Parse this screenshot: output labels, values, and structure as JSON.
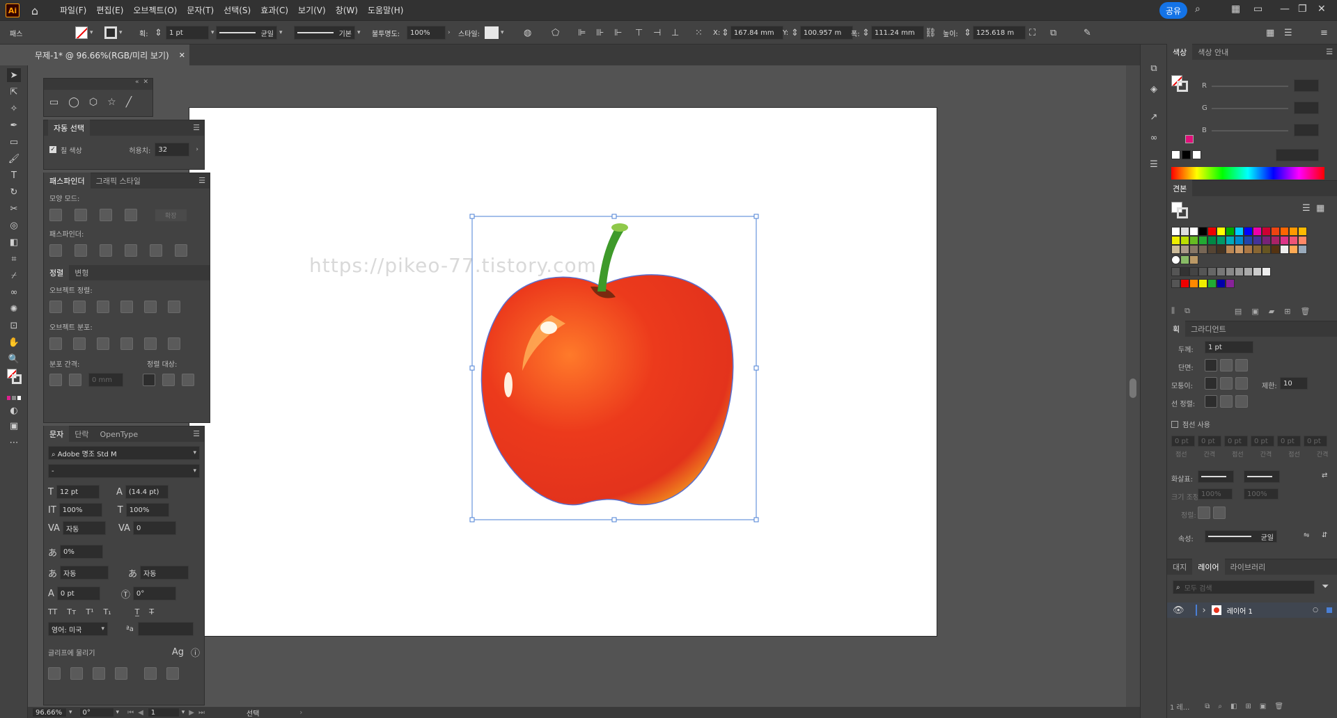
{
  "menubar": {
    "logo": "Ai",
    "items": [
      "파일(F)",
      "편집(E)",
      "오브젝트(O)",
      "문자(T)",
      "선택(S)",
      "효과(C)",
      "보기(V)",
      "창(W)",
      "도움말(H)"
    ],
    "share": "공유"
  },
  "control": {
    "type_label": "패스",
    "stroke_label": "획:",
    "stroke_value": "1 pt",
    "profile_label": "균일",
    "brush_label": "기본",
    "opacity_label": "불투명도:",
    "opacity_value": "100%",
    "style_label": "스타일:",
    "x_label": "X:",
    "x_value": "167.84 mm",
    "y_label": "Y:",
    "y_value": "100.957 m",
    "w_label": "폭:",
    "w_value": "111.24 mm",
    "h_label": "높이:",
    "h_value": "125.618 m"
  },
  "document": {
    "tab_title": "무제-1* @ 96.66%(RGB/미리 보기)",
    "watermark": "https://pikeo-77.tistory.com"
  },
  "panels": {
    "auto_select": {
      "title": "자동 선택",
      "fill_label": "칠 색상",
      "tolerance_label": "허용치:",
      "tolerance_value": "32"
    },
    "pathfinder": {
      "tab1": "패스파인더",
      "tab2": "그래픽 스타일",
      "shape_modes": "모양 모드:",
      "expand": "확장",
      "pathfinders": "패스파인더:"
    },
    "align": {
      "tab1": "정렬",
      "tab2": "변형",
      "align_objects": "오브젝트 정렬:",
      "distribute_objects": "오브젝트 분포:",
      "distribute_spacing": "분포 간격:",
      "align_to": "정렬 대상:",
      "spacing_value": "0 mm"
    },
    "character": {
      "tab1": "문자",
      "tab2": "단락",
      "tab3": "OpenType",
      "font": "Adobe 명조 Std M",
      "style": "-",
      "size": "12 pt",
      "leading": "(14.4 pt)",
      "vscale": "100%",
      "hscale": "100%",
      "kerning": "자동",
      "tracking": "0",
      "tsume": "0%",
      "aki_left": "자동",
      "aki_right": "자동",
      "baseline": "0 pt",
      "rotation": "0°",
      "language": "영어: 미국",
      "snap_label": "글리프에 물리기"
    }
  },
  "right": {
    "color": {
      "tab1": "색상",
      "tab2": "색상 안내",
      "r": "R",
      "g": "G",
      "b": "B"
    },
    "swatches": {
      "title": "견본"
    },
    "stroke": {
      "tab1": "획",
      "tab2": "그라디언트",
      "weight_label": "두께:",
      "weight_value": "1 pt",
      "cap_label": "단면:",
      "corner_label": "모퉁이:",
      "limit_label": "제한:",
      "limit_value": "10",
      "align_label": "선 정렬:",
      "dashed_label": "점선 사용",
      "dash_values": [
        "0 pt",
        "0 pt",
        "0 pt",
        "0 pt",
        "0 pt",
        "0 pt"
      ],
      "dash_labels": [
        "점선",
        "간격",
        "점선",
        "간격",
        "점선",
        "간격"
      ],
      "arrow_label": "화살표:",
      "scale_label": "크기 조정:",
      "scale1": "100%",
      "scale2": "100%",
      "align_arrow_label": "정렬:",
      "profile_label": "속성:",
      "profile_value": "균일"
    },
    "layers": {
      "tab1": "대지",
      "tab2": "레이어",
      "tab3": "라이브러리",
      "search_placeholder": "모두 검색",
      "layer_name": "레이어 1",
      "count": "1 레..."
    }
  },
  "status": {
    "zoom": "96.66%",
    "rotation": "0°",
    "artboard": "1",
    "tool": "선택"
  },
  "colors": {
    "accent": "#1473e6",
    "apple_red": "#e8321d",
    "stem_green": "#3e9a2a",
    "selection_blue": "#4a7fd6"
  }
}
